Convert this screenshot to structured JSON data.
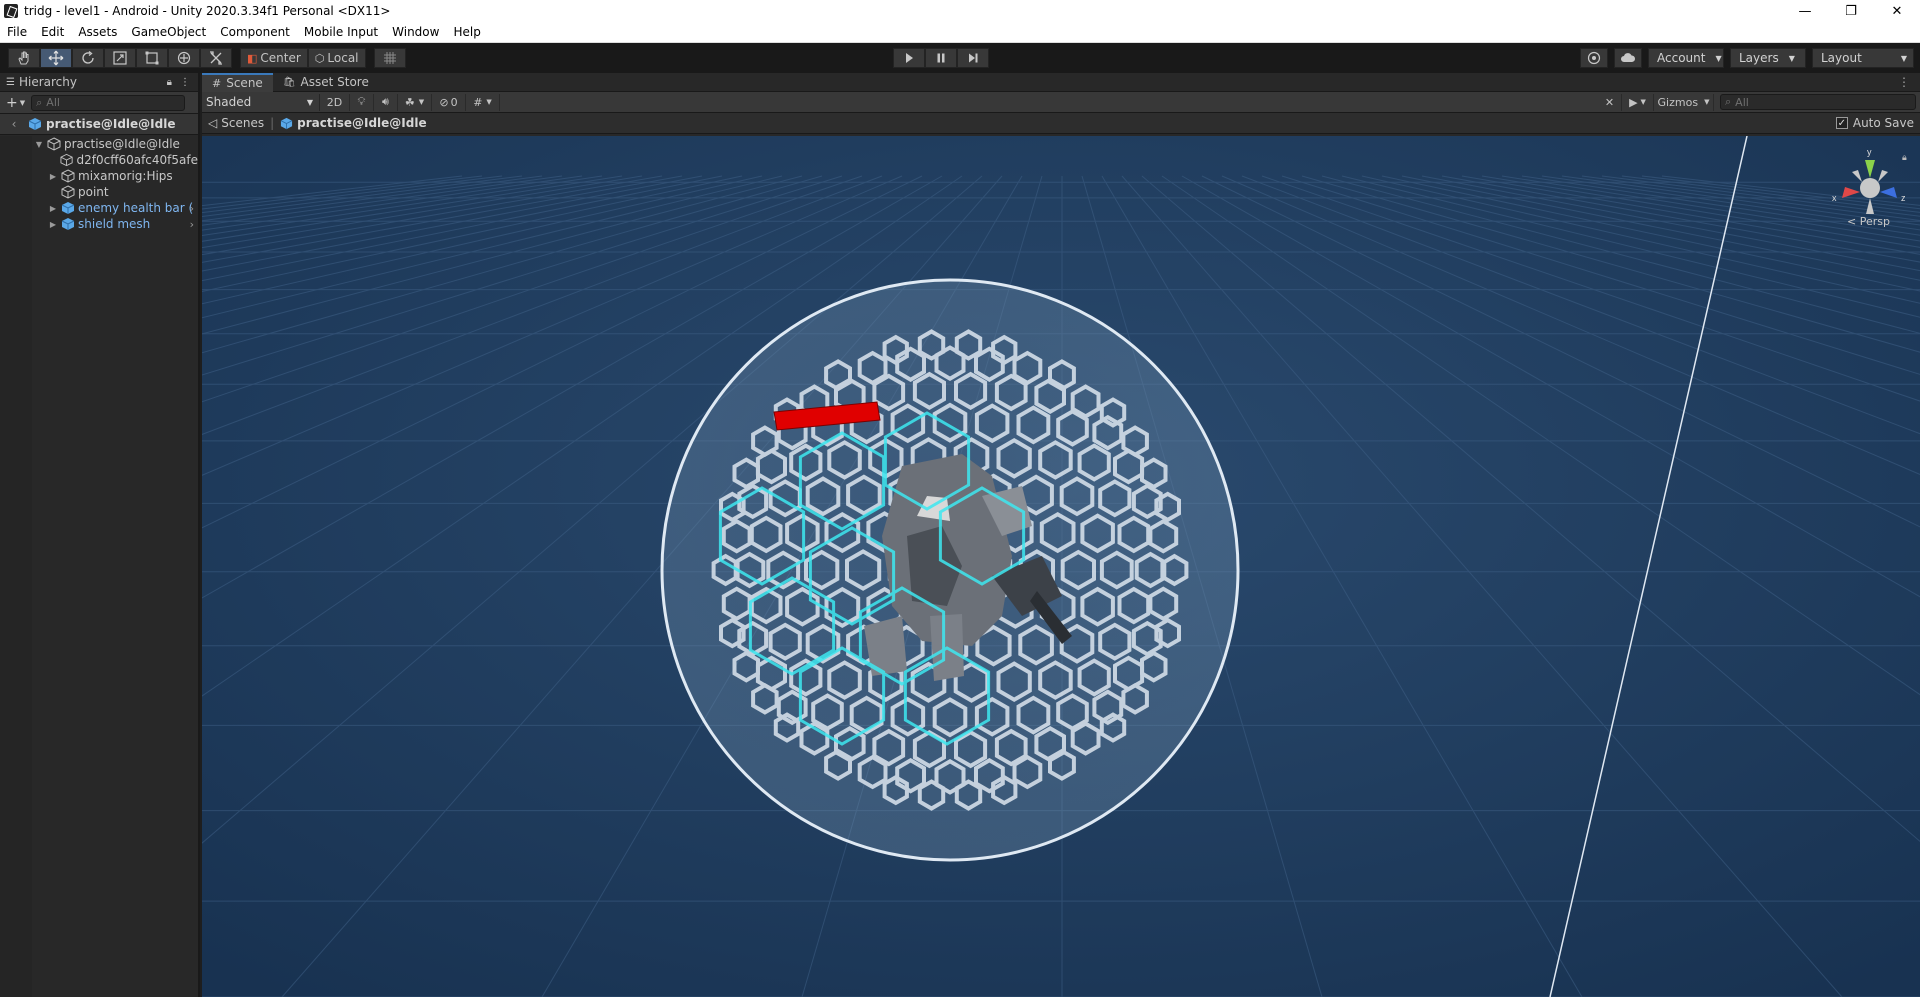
{
  "window": {
    "title": "tridg - level1 - Android - Unity 2020.3.34f1 Personal <DX11>",
    "controls": {
      "minimize": "—",
      "restore": "❐",
      "close": "✕"
    }
  },
  "menu": [
    "File",
    "Edit",
    "Assets",
    "GameObject",
    "Component",
    "Mobile Input",
    "Window",
    "Help"
  ],
  "toolbar": {
    "tools": [
      "hand-tool",
      "move-tool",
      "rotate-tool",
      "scale-tool",
      "rect-tool",
      "transform-tool",
      "custom-tool"
    ],
    "active_tool": "move-tool",
    "pivot_mode": "Center",
    "pivot_rotation": "Local",
    "account_label": "Account",
    "layers_label": "Layers",
    "layout_label": "Layout"
  },
  "hierarchy": {
    "tab_label": "Hierarchy",
    "search_placeholder": "All",
    "scene_name": "practise@Idle@Idle",
    "items": [
      {
        "label": "practise@Idle@Idle",
        "depth": 0,
        "expanded": true,
        "prefab": false,
        "has_children": true
      },
      {
        "label": "d2f0cff60afc40f5afe",
        "depth": 1,
        "expanded": false,
        "prefab": false,
        "has_children": false
      },
      {
        "label": "mixamorig:Hips",
        "depth": 1,
        "expanded": false,
        "prefab": false,
        "has_children": true
      },
      {
        "label": "point",
        "depth": 1,
        "expanded": false,
        "prefab": false,
        "has_children": false
      },
      {
        "label": "enemy health bar (",
        "depth": 1,
        "expanded": false,
        "prefab": true,
        "has_children": true
      },
      {
        "label": "shield mesh",
        "depth": 1,
        "expanded": false,
        "prefab": true,
        "has_children": true
      }
    ]
  },
  "scene": {
    "tabs": [
      {
        "label": "Scene",
        "active": true
      },
      {
        "label": "Asset Store",
        "active": false
      }
    ],
    "draw_mode": "Shaded",
    "mode_2d": "2D",
    "hidden_count": "0",
    "gizmos_label": "Gizmos",
    "search_placeholder": "All",
    "breadcrumb_root": "Scenes",
    "breadcrumb_current": "practise@Idle@Idle",
    "autosave_label": "Auto Save",
    "autosave_checked": true,
    "projection_label": "Persp",
    "axis_labels": {
      "x": "x",
      "y": "y",
      "z": "z"
    }
  },
  "colors": {
    "viewport_bg": "#1e3a5a",
    "health_bar": "#e00000",
    "highlight": "#3ee8f0",
    "accent_blue": "#3a79bb"
  }
}
